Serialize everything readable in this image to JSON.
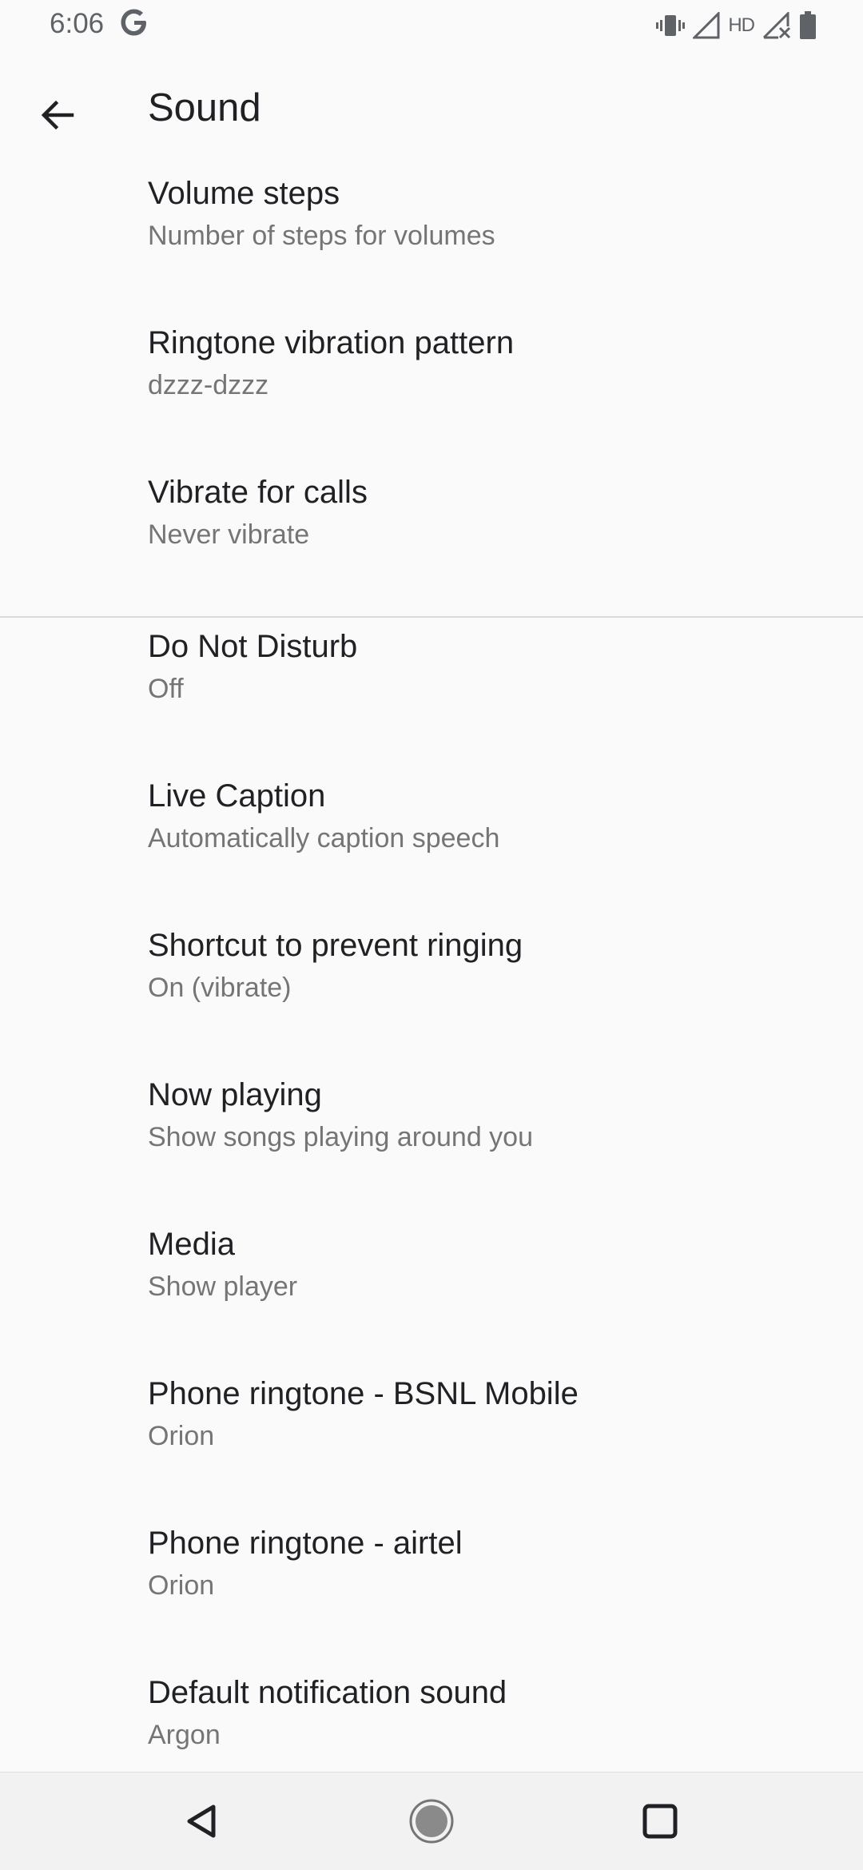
{
  "status_bar": {
    "time": "6:06",
    "google_icon": "google-g-icon",
    "icons": [
      "vibrate-icon",
      "signal-icon",
      "hd-icon",
      "signal-no-data-icon",
      "battery-icon"
    ],
    "hd_label": "HD"
  },
  "app_bar": {
    "back_icon": "arrow-back-icon",
    "title": "Sound"
  },
  "items": [
    {
      "title": "Volume steps",
      "summary": "Number of steps for volumes"
    },
    {
      "title": "Ringtone vibration pattern",
      "summary": "dzzz-dzzz"
    },
    {
      "title": "Vibrate for calls",
      "summary": "Never vibrate"
    },
    {
      "title": "Do Not Disturb",
      "summary": "Off"
    },
    {
      "title": "Live Caption",
      "summary": "Automatically caption speech"
    },
    {
      "title": "Shortcut to prevent ringing",
      "summary": "On (vibrate)"
    },
    {
      "title": "Now playing",
      "summary": "Show songs playing around you"
    },
    {
      "title": "Media",
      "summary": "Show player"
    },
    {
      "title": "Phone ringtone - BSNL Mobile",
      "summary": "Orion"
    },
    {
      "title": "Phone ringtone - airtel",
      "summary": "Orion"
    },
    {
      "title": "Default notification sound",
      "summary": "Argon"
    }
  ],
  "nav_bar": {
    "icons": [
      "nav-back-icon",
      "nav-home-icon",
      "nav-recents-icon"
    ]
  },
  "colors": {
    "background": "#fafafa",
    "title_text": "#202124",
    "summary_text": "#757575",
    "divider": "#dadada",
    "nav_bar": "#f2f2f2"
  }
}
